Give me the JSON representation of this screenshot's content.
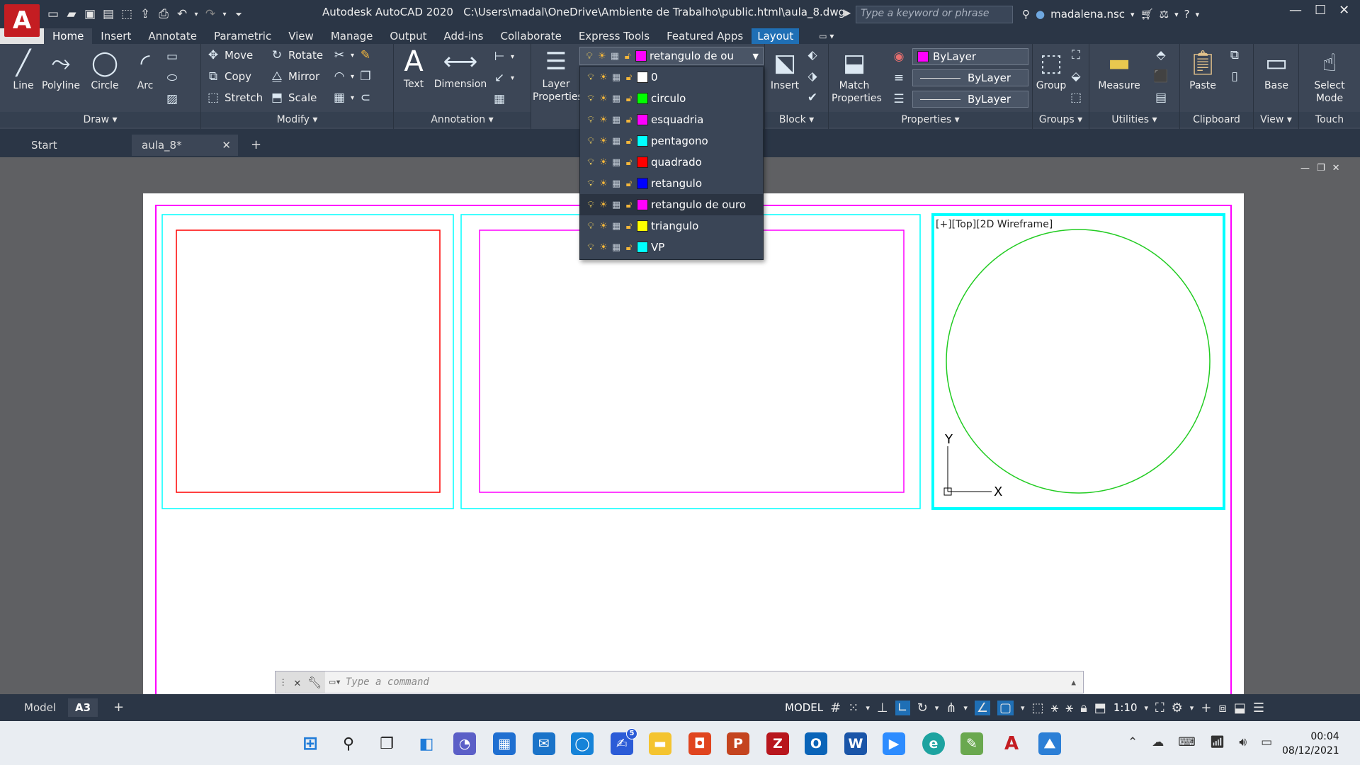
{
  "app": {
    "logo": "A",
    "title": "Autodesk AutoCAD 2020",
    "file_path": "C:\\Users\\madal\\OneDrive\\Ambiente de Trabalho\\public.html\\aula_8.dwg"
  },
  "search": {
    "placeholder": "Type a keyword or phrase"
  },
  "user": {
    "name": "madalena.nsc"
  },
  "ribbon_tabs": [
    "Home",
    "Insert",
    "Annotate",
    "Parametric",
    "View",
    "Manage",
    "Output",
    "Add-ins",
    "Collaborate",
    "Express Tools",
    "Featured Apps",
    "Layout"
  ],
  "draw_panel": {
    "title": "Draw",
    "tools": [
      "Line",
      "Polyline",
      "Circle",
      "Arc"
    ]
  },
  "modify_panel": {
    "title": "Modify",
    "tools": [
      "Move",
      "Rotate",
      "Copy",
      "Mirror",
      "Stretch",
      "Scale"
    ]
  },
  "annotation_panel": {
    "title": "Annotation",
    "tools": [
      "Text",
      "Dimension"
    ]
  },
  "layers_panel": {
    "tool": "Layer Properties",
    "current": "retangulo de ou"
  },
  "layer_list": [
    {
      "name": "0",
      "color": "#ffffff"
    },
    {
      "name": "circulo",
      "color": "#00ff00"
    },
    {
      "name": "esquadria",
      "color": "#ff00ff"
    },
    {
      "name": "pentagono",
      "color": "#00ffff"
    },
    {
      "name": "quadrado",
      "color": "#ff0000"
    },
    {
      "name": "retangulo",
      "color": "#0000ff"
    },
    {
      "name": "retangulo de ouro",
      "color": "#ff00ff"
    },
    {
      "name": "triangulo",
      "color": "#ffff00"
    },
    {
      "name": "VP",
      "color": "#00ffff"
    }
  ],
  "block_panel": {
    "title": "Block",
    "tool": "Insert"
  },
  "properties_panel": {
    "title": "Properties",
    "tool": "Match Properties",
    "color": "ByLayer",
    "lineweight": "ByLayer",
    "linetype": "ByLayer"
  },
  "groups_panel": {
    "title": "Groups",
    "tool": "Group"
  },
  "utilities_panel": {
    "title": "Utilities",
    "tool": "Measure"
  },
  "clipboard_panel": {
    "title": "Clipboard",
    "tool": "Paste"
  },
  "view_panel": {
    "title": "View",
    "tool": "Base"
  },
  "touch_panel": {
    "title": "Touch",
    "tool": "Select Mode"
  },
  "doc_tabs": {
    "start": "Start",
    "file": "aula_8*"
  },
  "viewport_label": "[+][Top][2D Wireframe]",
  "ucs": {
    "x": "X",
    "y": "Y"
  },
  "command": {
    "placeholder": "Type a command"
  },
  "layout_tabs": [
    "Model",
    "A3"
  ],
  "status": {
    "mode": "MODEL",
    "scale": "1:10"
  },
  "clock": {
    "time": "00:04",
    "date": "08/12/2021"
  },
  "taskbar_badge": "5"
}
